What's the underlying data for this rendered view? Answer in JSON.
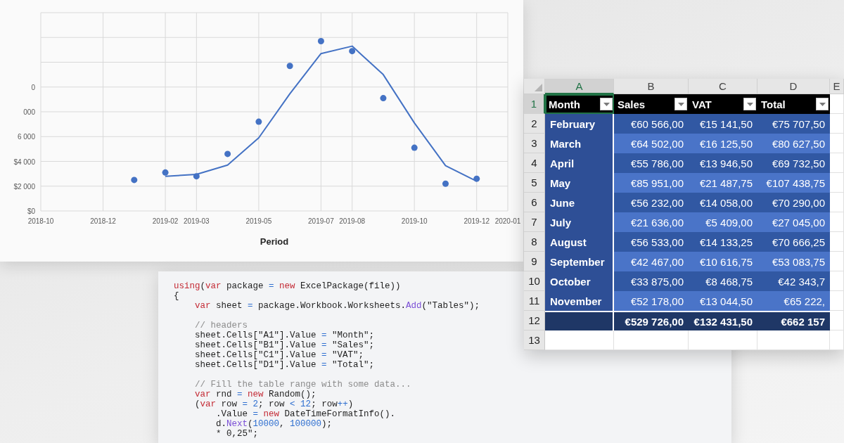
{
  "chart": {
    "cut_y_labels": [
      "0",
      "000"
    ],
    "chart_data": {
      "type": "scatter",
      "xlabel": "Period",
      "ylim": [
        0,
        16000
      ],
      "grid": true,
      "categories": [
        "2018-10",
        null,
        "2018-12",
        null,
        "2019-02",
        "2019-03",
        null,
        "2019-05",
        null,
        "2019-07",
        "2019-08",
        null,
        "2019-10",
        null,
        "2019-12",
        "2020-01"
      ],
      "yticks": [
        {
          "value": 0,
          "label": "$0"
        },
        {
          "value": 2000,
          "label": "$2 000"
        },
        {
          "value": 4000,
          "label": "$4 000"
        },
        {
          "value": 6000,
          "label": "6 000"
        }
      ],
      "series": [
        {
          "type": "scatter",
          "color": "#4472c4",
          "values": [
            null,
            null,
            null,
            2500,
            3100,
            2800,
            4600,
            7200,
            11700,
            13700,
            12900,
            9100,
            5100,
            2200,
            2600,
            null
          ]
        },
        {
          "type": "line",
          "color": "#4472c4",
          "values": [
            null,
            null,
            null,
            null,
            2800,
            2950,
            3700,
            5900,
            9450,
            12700,
            13300,
            11000,
            7100,
            3650,
            2400,
            null
          ]
        }
      ]
    }
  },
  "code": {
    "lines": [
      {
        "kind": "code",
        "tokens": [
          {
            "kind": "keyword",
            "text": "using"
          },
          {
            "kind": "plain",
            "text": "("
          },
          {
            "kind": "keyword",
            "text": "var"
          },
          {
            "kind": "plain",
            "text": " package "
          },
          {
            "kind": "operator",
            "text": "= "
          },
          {
            "kind": "keyword",
            "text": "new"
          },
          {
            "kind": "plain",
            "text": " ExcelPackage(file))"
          }
        ]
      },
      {
        "kind": "code",
        "tokens": [
          {
            "kind": "plain",
            "text": "{"
          }
        ],
        "children": [
          {
            "kind": "code",
            "tokens": [
              {
                "kind": "keyword",
                "text": "var"
              },
              {
                "kind": "plain",
                "text": " sheet "
              },
              {
                "kind": "operator",
                "text": "= "
              },
              {
                "kind": "plain",
                "text": "package.Workbook.Worksheets."
              },
              {
                "kind": "method",
                "text": "Add"
              },
              {
                "kind": "plain",
                "text": "(\"Tables\");"
              }
            ]
          },
          {
            "kind": "blank"
          },
          {
            "kind": "code",
            "tokens": [
              {
                "kind": "comment",
                "text": "// headers"
              }
            ]
          },
          {
            "kind": "code",
            "tokens": [
              {
                "kind": "plain",
                "text": "sheet.Cells[\"A1\"].Value "
              },
              {
                "kind": "operator",
                "text": "= "
              },
              {
                "kind": "plain",
                "text": "\"Month\";"
              }
            ]
          },
          {
            "kind": "code",
            "tokens": [
              {
                "kind": "plain",
                "text": "sheet.Cells[\"B1\"].Value "
              },
              {
                "kind": "operator",
                "text": "= "
              },
              {
                "kind": "plain",
                "text": "\"Sales\";"
              }
            ]
          },
          {
            "kind": "code",
            "tokens": [
              {
                "kind": "plain",
                "text": "sheet.Cells[\"C1\"].Value "
              },
              {
                "kind": "operator",
                "text": "= "
              },
              {
                "kind": "plain",
                "text": "\"VAT\";"
              }
            ]
          },
          {
            "kind": "code",
            "tokens": [
              {
                "kind": "plain",
                "text": "sheet.Cells[\"D1\"].Value "
              },
              {
                "kind": "operator",
                "text": "= "
              },
              {
                "kind": "plain",
                "text": "\"Total\";"
              }
            ]
          },
          {
            "kind": "blank"
          },
          {
            "kind": "code",
            "tokens": [
              {
                "kind": "comment",
                "text": "// Fill the table range with some data..."
              }
            ]
          },
          {
            "kind": "code",
            "tokens": [
              {
                "kind": "keyword",
                "text": "var"
              },
              {
                "kind": "plain",
                "text": " rnd "
              },
              {
                "kind": "operator",
                "text": "= "
              },
              {
                "kind": "keyword",
                "text": "new"
              },
              {
                "kind": "plain",
                "text": " Random();"
              }
            ]
          },
          {
            "kind": "code",
            "tokens": [
              {
                "kind": "plain",
                "text": "("
              },
              {
                "kind": "keyword",
                "text": "var"
              },
              {
                "kind": "plain",
                "text": " row "
              },
              {
                "kind": "operator",
                "text": "= "
              },
              {
                "kind": "number",
                "text": "2"
              },
              {
                "kind": "plain",
                "text": "; row "
              },
              {
                "kind": "operator",
                "text": "< "
              },
              {
                "kind": "number",
                "text": "12"
              },
              {
                "kind": "plain",
                "text": "; row"
              },
              {
                "kind": "operator",
                "text": "++"
              },
              {
                "kind": "plain",
                "text": ")"
              }
            ],
            "children": [
              {
                "kind": "code",
                "tokens": [
                  {
                    "kind": "plain",
                    "text": ".Value "
                  },
                  {
                    "kind": "operator",
                    "text": "= "
                  },
                  {
                    "kind": "keyword",
                    "text": "new"
                  },
                  {
                    "kind": "plain",
                    "text": " DateTimeFormatInfo()."
                  }
                ]
              },
              {
                "kind": "code",
                "tokens": [
                  {
                    "kind": "plain",
                    "text": "d."
                  },
                  {
                    "kind": "method",
                    "text": "Next"
                  },
                  {
                    "kind": "plain",
                    "text": "("
                  },
                  {
                    "kind": "number",
                    "text": "10000"
                  },
                  {
                    "kind": "plain",
                    "text": ", "
                  },
                  {
                    "kind": "number",
                    "text": "100000"
                  },
                  {
                    "kind": "plain",
                    "text": ");"
                  }
                ]
              },
              {
                "kind": "code",
                "tokens": [
                  {
                    "kind": "plain",
                    "text": "* 0,25\";"
                  }
                ]
              }
            ]
          }
        ]
      }
    ]
  },
  "spreadsheet": {
    "columns": [
      {
        "label": "A",
        "selected": true
      },
      {
        "label": "B",
        "selected": false
      },
      {
        "label": "C",
        "selected": false
      },
      {
        "label": "D",
        "selected": false
      },
      {
        "label": "E",
        "selected": false
      }
    ],
    "rows": [
      {
        "number": "1",
        "kind": "header",
        "selected": true,
        "cells": [
          {
            "text": "Month",
            "selected": true
          },
          {
            "text": "Sales",
            "selected": false
          },
          {
            "text": "VAT",
            "selected": false
          },
          {
            "text": "Total",
            "selected": false
          }
        ]
      },
      {
        "number": "2",
        "kind": "data",
        "selected": false,
        "cells": [
          "February",
          "€60 566,00",
          "€15 141,50",
          "€75 707,50"
        ]
      },
      {
        "number": "3",
        "kind": "data",
        "selected": false,
        "cells": [
          "March",
          "€64 502,00",
          "€16 125,50",
          "€80 627,50"
        ]
      },
      {
        "number": "4",
        "kind": "data",
        "selected": false,
        "cells": [
          "April",
          "€55 786,00",
          "€13 946,50",
          "€69 732,50"
        ]
      },
      {
        "number": "5",
        "kind": "data",
        "selected": false,
        "cells": [
          "May",
          "€85 951,00",
          "€21 487,75",
          "€107 438,75"
        ]
      },
      {
        "number": "6",
        "kind": "data",
        "selected": false,
        "cells": [
          "June",
          "€56 232,00",
          "€14 058,00",
          "€70 290,00"
        ]
      },
      {
        "number": "7",
        "kind": "data",
        "selected": false,
        "cells": [
          "July",
          "€21 636,00",
          "€5 409,00",
          "€27 045,00"
        ]
      },
      {
        "number": "8",
        "kind": "data",
        "selected": false,
        "cells": [
          "August",
          "€56 533,00",
          "€14 133,25",
          "€70 666,25"
        ]
      },
      {
        "number": "9",
        "kind": "data",
        "selected": false,
        "cells": [
          "September",
          "€42 467,00",
          "€10 616,75",
          "€53 083,75"
        ]
      },
      {
        "number": "10",
        "kind": "data",
        "selected": false,
        "cells": [
          "October",
          "€33 875,00",
          "€8 468,75",
          "€42 343,7"
        ]
      },
      {
        "number": "11",
        "kind": "data",
        "selected": false,
        "cells": [
          "November",
          "€52 178,00",
          "€13 044,50",
          "€65 222,"
        ]
      },
      {
        "number": "12",
        "kind": "total",
        "selected": false,
        "cells": [
          "€529 726,00",
          "€132 431,50",
          "€662 157"
        ]
      },
      {
        "number": "13",
        "kind": "empty",
        "selected": false
      }
    ]
  }
}
